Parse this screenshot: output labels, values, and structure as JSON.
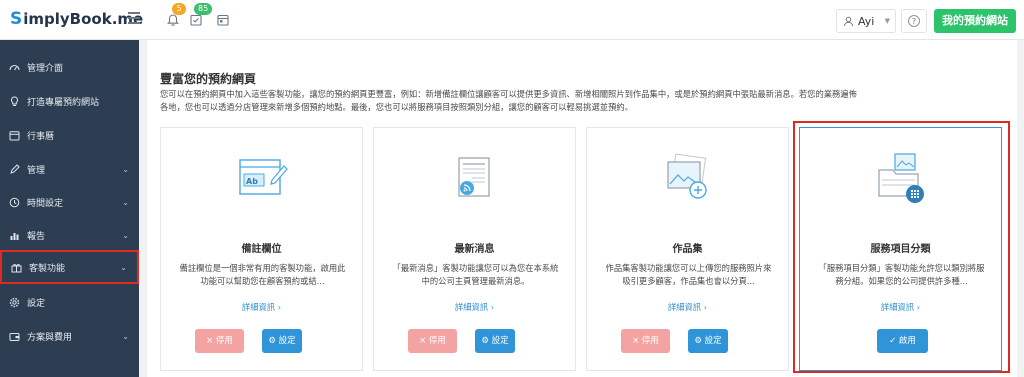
{
  "app": {
    "logo_mark": "S",
    "logo_text": "implyBook.me"
  },
  "topbar": {
    "bell_badge": "5",
    "tasks_badge": "85",
    "user_name": "Ayi",
    "help_label": "?",
    "site_button": "我的預約網站"
  },
  "sidebar": {
    "items": [
      {
        "label": "管理介面",
        "icon": "dashboard-icon",
        "chevron": ""
      },
      {
        "label": "打造專屬預約網站",
        "icon": "lightbulb-icon",
        "chevron": ""
      },
      {
        "label": "行事曆",
        "icon": "calendar-icon",
        "chevron": ""
      },
      {
        "label": "管理",
        "icon": "pencil-icon",
        "chevron": "⌄"
      },
      {
        "label": "時間設定",
        "icon": "clock-icon",
        "chevron": "⌄"
      },
      {
        "label": "報告",
        "icon": "chart-icon",
        "chevron": "⌄"
      },
      {
        "label": "客製功能",
        "icon": "gift-icon",
        "chevron": "⌄"
      },
      {
        "label": "設定",
        "icon": "gear-icon",
        "chevron": ""
      },
      {
        "label": "方案與費用",
        "icon": "wallet-icon",
        "chevron": "⌄"
      }
    ]
  },
  "main": {
    "title": "豐富您的預約網頁",
    "description": "您可以在預約網頁中加入這些客製功能，讓您的預約網頁更豐富，例如：新增備註欄位讓顧客可以提供更多資訊、新增相關照片到作品集中，或是於預約網頁中張貼最新消息。若您的業務遍佈各地，您也可以透過分店管理來新增多個預約地點。最後，您也可以將服務項目按照類別分組，讓您的顧客可以輕易挑選並預約。",
    "cards": [
      {
        "title": "備註欄位",
        "text": "備註欄位是一個非常有用的客製功能，啟用此功能可以幫助您在顧客預約或結...",
        "more": "詳細資訊 ›",
        "disable": "× 停用",
        "settings": "⚙ 設定"
      },
      {
        "title": "最新消息",
        "text": "「最新消息」客製功能讓您可以為您在本系統中的公司主頁管理最新消息。",
        "more": "詳細資訊 ›",
        "disable": "× 停用",
        "settings": "⚙ 設定"
      },
      {
        "title": "作品集",
        "text": "作品集客製功能讓您可以上傳您的服務照片來吸引更多顧客，作品集也會以分頁...",
        "more": "詳細資訊 ›",
        "disable": "× 停用",
        "settings": "⚙ 設定"
      },
      {
        "title": "服務項目分類",
        "text": "「服務項目分類」客製功能允許您以類別將服務分組。如果您的公司提供許多種...",
        "more": "詳細資訊 ›",
        "enable": "✓ 啟用"
      }
    ]
  },
  "colors": {
    "accent": "#2f94d8",
    "green": "#2cc46b",
    "sidebar": "#2e3e52",
    "highlight": "#e02a1f",
    "disable": "#f4a3a3"
  }
}
